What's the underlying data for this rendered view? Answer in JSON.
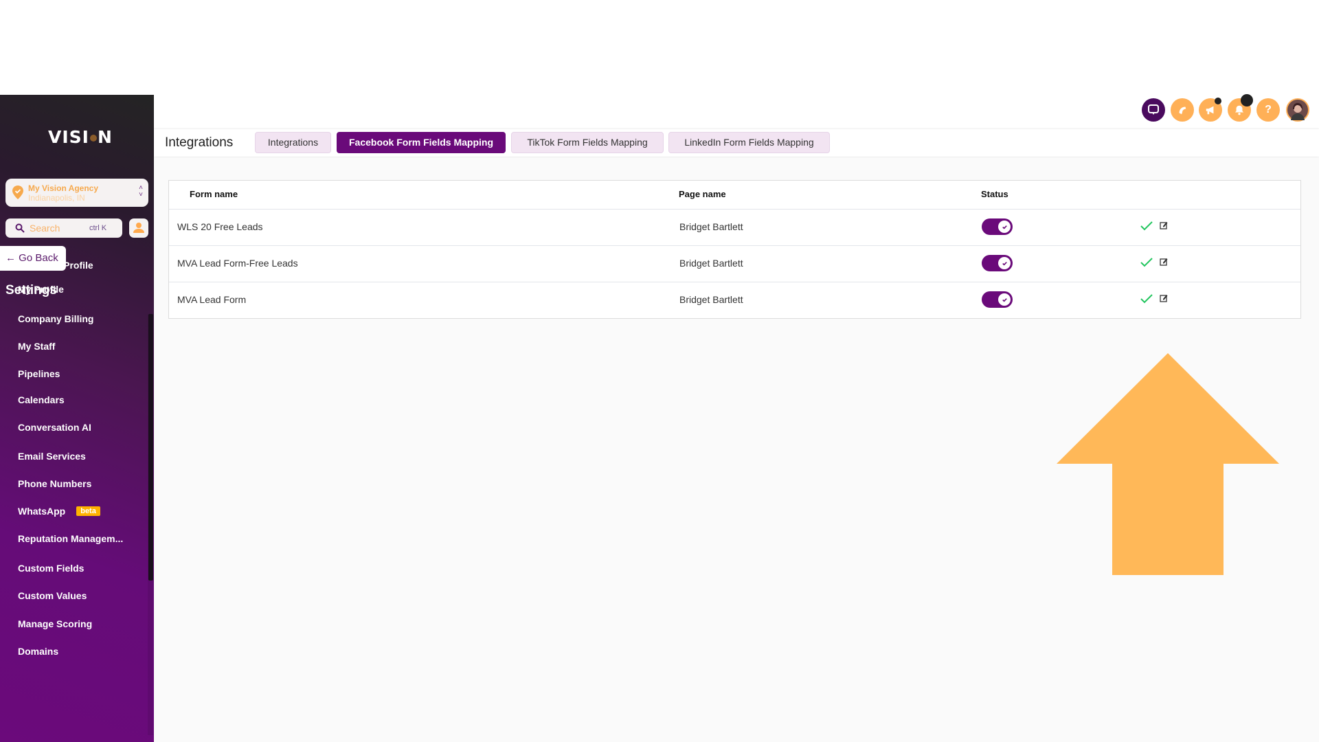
{
  "brand": {
    "logo_text_left": "VISI",
    "logo_text_right": "N"
  },
  "location": {
    "name": "My Vision Agency",
    "city": "Indianapolis, IN"
  },
  "search": {
    "placeholder": "Search",
    "shortcut": "ctrl K"
  },
  "go_back_label": "← Go Back",
  "sidebar": {
    "title": "Settings",
    "items": [
      {
        "label": "Business Profile"
      },
      {
        "label": "My Profile"
      },
      {
        "label": "Company Billing"
      },
      {
        "label": "My Staff"
      },
      {
        "label": "Pipelines"
      },
      {
        "label": "Calendars"
      },
      {
        "label": "Conversation AI"
      },
      {
        "label": "Email Services"
      },
      {
        "label": "Phone Numbers"
      },
      {
        "label": "WhatsApp",
        "badge": "beta"
      },
      {
        "label": "Reputation Managem..."
      },
      {
        "label": "Custom Fields"
      },
      {
        "label": "Custom Values"
      },
      {
        "label": "Manage Scoring"
      },
      {
        "label": "Domains"
      }
    ]
  },
  "header_icons": [
    "chat-icon",
    "phone-icon",
    "megaphone-icon",
    "bell-icon",
    "help-icon",
    "user-avatar"
  ],
  "tabbar": {
    "breadcrumb": "Integrations",
    "tabs": [
      {
        "label": "Integrations",
        "active": false
      },
      {
        "label": "Facebook Form Fields Mapping",
        "active": true
      },
      {
        "label": "TikTok Form Fields Mapping",
        "active": false
      },
      {
        "label": "LinkedIn Form Fields Mapping",
        "active": false
      }
    ]
  },
  "table": {
    "columns": [
      "Form name",
      "Page name",
      "Status"
    ],
    "rows": [
      {
        "form_name": "WLS 20 Free Leads",
        "page_name": "Bridget Bartlett",
        "status_on": true
      },
      {
        "form_name": "MVA Lead Form-Free Leads",
        "page_name": "Bridget Bartlett",
        "status_on": true
      },
      {
        "form_name": "MVA Lead Form",
        "page_name": "Bridget Bartlett",
        "status_on": true
      }
    ]
  },
  "colors": {
    "brand_purple": "#6a0a7a",
    "accent_orange": "#ffb057",
    "success_green": "#22c55e",
    "annotation_arrow": "#ffb858"
  }
}
